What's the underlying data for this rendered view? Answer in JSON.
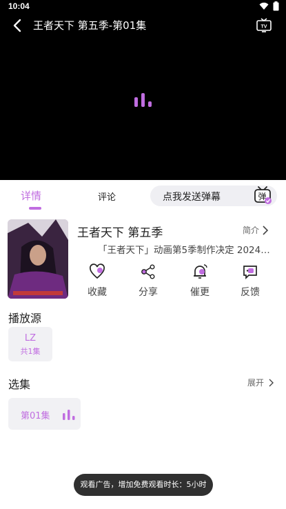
{
  "status_bar": {
    "time": "10:04"
  },
  "player": {
    "title": "王者天下 第五季-第01集",
    "accent": "#c06de0"
  },
  "tabs": {
    "detail": "详情",
    "comment": "评论",
    "danmaku_placeholder": "点我发送弹幕",
    "danmaku_icon_text": "弹"
  },
  "show": {
    "title": "王者天下 第五季",
    "intro_label": "简介",
    "description": "「王者天下」动画第5季制作决定 2024年…"
  },
  "actions": [
    {
      "label": "收藏",
      "icon": "heart-icon"
    },
    {
      "label": "分享",
      "icon": "share-icon"
    },
    {
      "label": "催更",
      "icon": "bell-icon"
    },
    {
      "label": "反馈",
      "icon": "feedback-icon"
    }
  ],
  "sources": {
    "title": "播放源",
    "items": [
      {
        "name": "LZ",
        "count": "共1集"
      }
    ]
  },
  "episodes": {
    "title": "选集",
    "expand_label": "展开",
    "items": [
      {
        "label": "第01集"
      }
    ]
  },
  "toast": "观看广告，增加免费观看时长：5小时"
}
